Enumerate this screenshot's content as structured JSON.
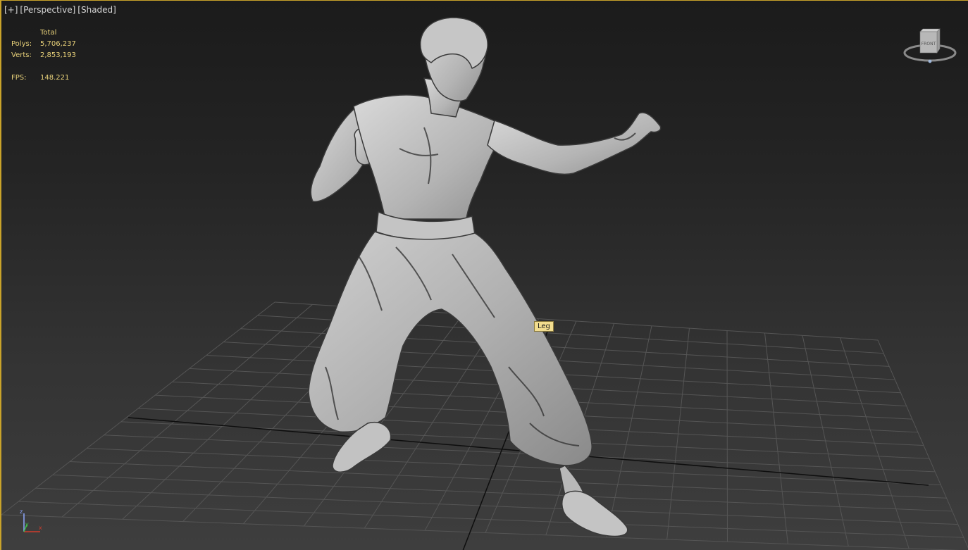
{
  "viewport": {
    "labels": [
      "[+]",
      "[Perspective]",
      "[Shaded]"
    ]
  },
  "stats": {
    "header": "Total",
    "polys_label": "Polys:",
    "polys_value": "5,706,237",
    "verts_label": "Verts:",
    "verts_value": "2,853,193",
    "fps_label": "FPS:",
    "fps_value": "148.221"
  },
  "viewcube": {
    "face_label": "FRONT"
  },
  "tooltip": {
    "text": "Leg"
  },
  "axis": {
    "z": "z",
    "y": "y",
    "x": "x"
  },
  "colors": {
    "border": "#c9a32a",
    "stats_text": "#e9d27a",
    "tooltip_bg": "#f2dd8f",
    "axis_x": "#d23c2c",
    "axis_y": "#3fbf4a",
    "axis_z": "#8fa8ff"
  }
}
